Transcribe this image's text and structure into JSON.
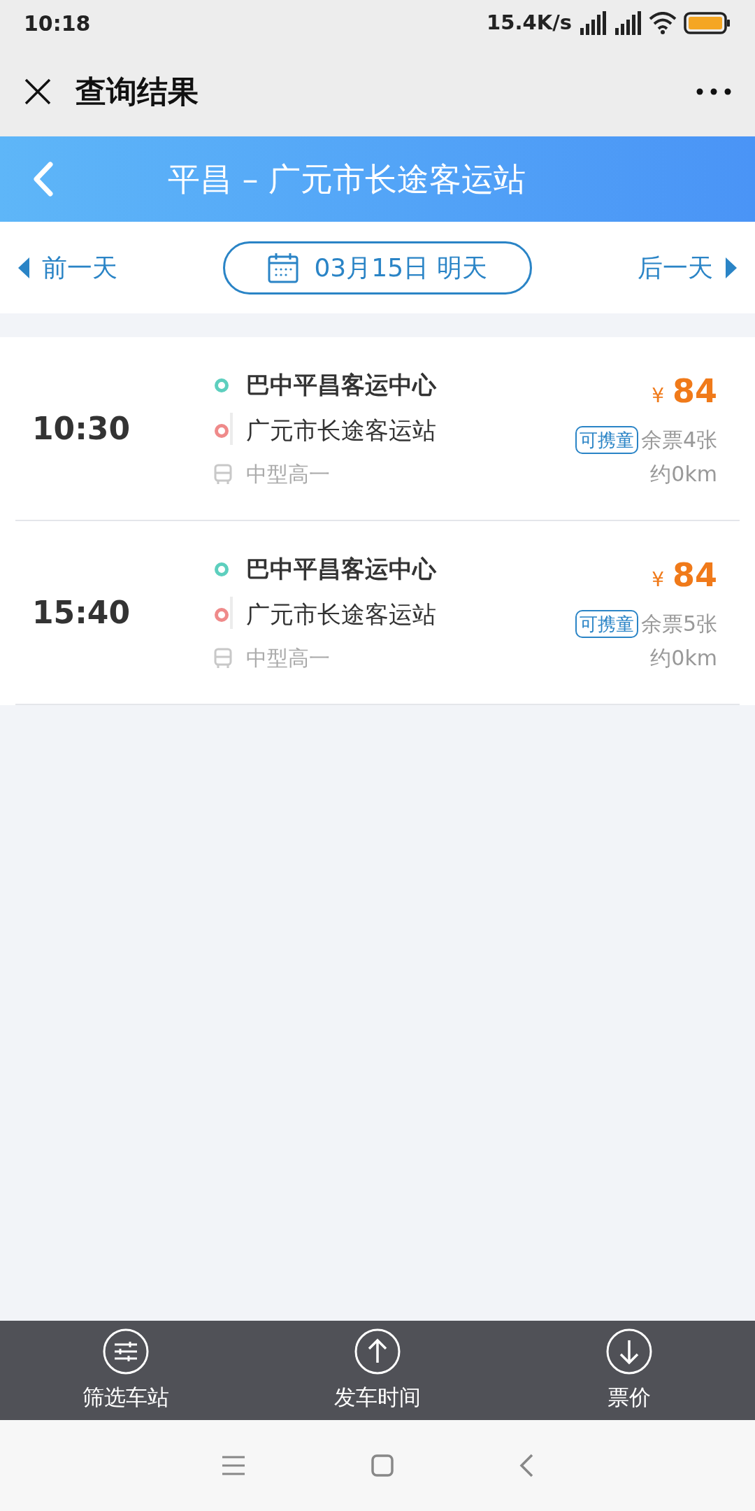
{
  "status_bar": {
    "time": "10:18",
    "speed": "15.4K/s"
  },
  "title_bar": {
    "title": "查询结果"
  },
  "route_header": {
    "title": "平昌 – 广元市长途客运站"
  },
  "date_bar": {
    "prev": "前一天",
    "date": "03月15日 明天",
    "next": "后一天"
  },
  "trips": [
    {
      "time": "10:30",
      "from": "巴中平昌客运中心",
      "to": "广元市长途客运站",
      "bus_type": "中型高一",
      "currency": "¥",
      "price": "84",
      "tag": "可携童",
      "remaining": "余票4张",
      "distance": "约0km"
    },
    {
      "time": "15:40",
      "from": "巴中平昌客运中心",
      "to": "广元市长途客运站",
      "bus_type": "中型高一",
      "currency": "¥",
      "price": "84",
      "tag": "可携童",
      "remaining": "余票5张",
      "distance": "约0km"
    }
  ],
  "bottom_bar": [
    {
      "kind": "filter",
      "label": "筛选车站"
    },
    {
      "kind": "up",
      "label": "发车时间"
    },
    {
      "kind": "down",
      "label": "票价"
    }
  ]
}
